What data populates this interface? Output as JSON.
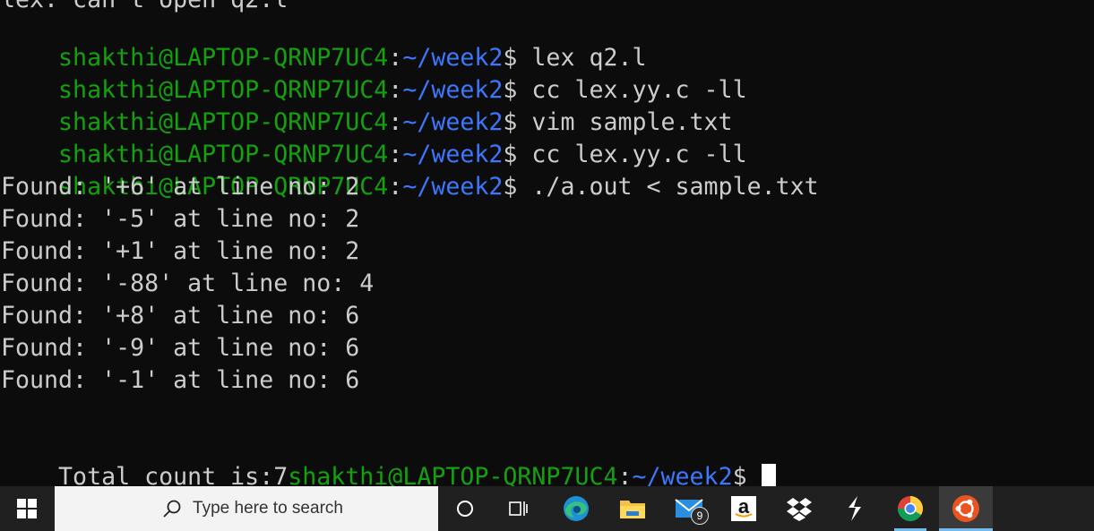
{
  "terminal": {
    "partial_top": "lex: can't open q2.l",
    "prompt": {
      "user": "shakthi@LAPTOP-QRNP7UC4",
      "colon": ":",
      "path": "~/week2",
      "dollar": "$"
    },
    "commands": [
      " lex q2.l",
      " cc lex.yy.c -ll",
      " vim sample.txt",
      " cc lex.yy.c -ll",
      " ./a.out < sample.txt"
    ],
    "output": [
      "Found: '+6' at line no: 2",
      "Found: '-5' at line no: 2",
      "Found: '+1' at line no: 2",
      "Found: '-88' at line no: 4",
      "Found: '+8' at line no: 6",
      "Found: '-9' at line no: 6",
      "Found: '-1' at line no: 6"
    ],
    "total_text": "Total count is:7",
    "final_prompt_tail": " "
  },
  "taskbar": {
    "search_placeholder": "Type here to search",
    "mail_badge": "9",
    "amazon_letter": "a",
    "icons": [
      "windows-start-icon",
      "search-icon",
      "cortana-icon",
      "task-view-icon",
      "edge-icon",
      "file-explorer-icon",
      "mail-icon",
      "amazon-icon",
      "dropbox-icon",
      "sublime-icon",
      "chrome-icon",
      "ubuntu-icon"
    ]
  },
  "colors": {
    "prompt_user": "#13a10e",
    "prompt_path": "#3b78ff",
    "text": "#cccccc",
    "background": "#0c0c0c",
    "taskbar": "#202020"
  }
}
